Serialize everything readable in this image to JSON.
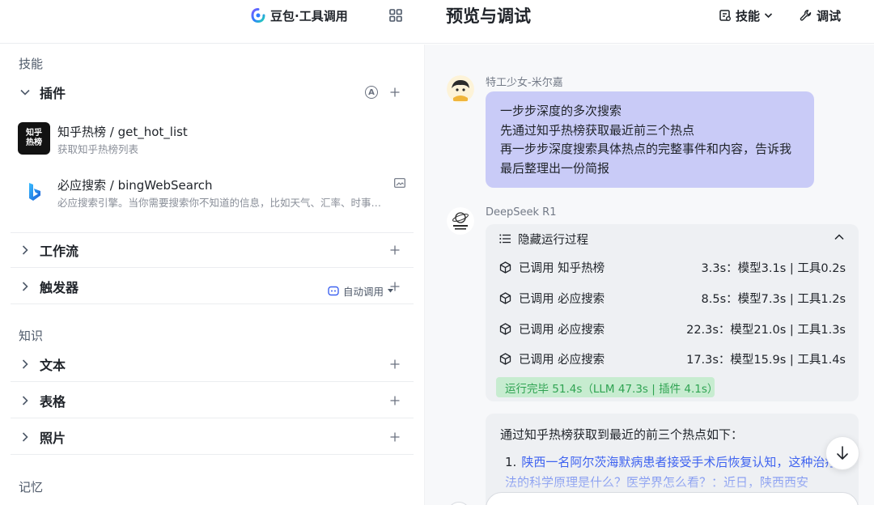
{
  "header": {
    "app_title": "豆包·工具调用",
    "preview_title": "预览与调试",
    "skill_label": "技能",
    "debug_label": "调试"
  },
  "left": {
    "skills_label": "技能",
    "plugins_label": "插件",
    "plugins_badge": "A",
    "plugins": [
      {
        "name": "知乎热榜 / get_hot_list",
        "desc": "获取知乎热榜列表",
        "icon_text": "知乎\n热榜"
      },
      {
        "name": "必应搜索 / bingWebSearch",
        "desc": "必应搜索引擎。当你需要搜索你不知道的信息，比如天气、汇率、时事…"
      }
    ],
    "workflow_label": "工作流",
    "trigger_label": "触发器",
    "knowledge_label": "知识",
    "auto_call_label": "自动调用",
    "text_label": "文本",
    "table_label": "表格",
    "photo_label": "照片",
    "memory_label": "记忆"
  },
  "chat": {
    "user_name": "特工少女-米尔嘉",
    "user_message_lines": [
      "一步步深度的多次搜索",
      "先通过知乎热榜获取最近前三个热点",
      "再一步步深度搜索具体热点的完整事件和内容，告诉我",
      "最后整理出一份简报"
    ],
    "bot_name": "DeepSeek R1",
    "run_header": "隐藏运行过程",
    "calls": [
      {
        "label": "已调用  知乎热榜",
        "time": "3.3s：模型3.1s | 工具0.2s"
      },
      {
        "label": "已调用  必应搜索",
        "time": "8.5s：模型7.3s | 工具1.2s"
      },
      {
        "label": "已调用  必应搜索",
        "time": "22.3s：模型21.0s | 工具1.3s"
      },
      {
        "label": "已调用  必应搜索",
        "time": "17.3s：模型15.9s | 工具1.4s"
      }
    ],
    "done_text": "运行完毕 51.4s（LLM 47.3s | 插件 4.1s）",
    "answer_intro": "通过知乎热榜获取到最近的前三个热点如下：",
    "answer_item_num": "1.",
    "answer_item_text": "陕西一名阿尔茨海默病患者接受手术后恢复认知，这种治疗方法的科学原理是什么？医学界怎么看？：近日，陕西西安"
  },
  "colors": {
    "user_bubble": "#c9cbf7",
    "done_badge_bg": "#c7ecd0",
    "done_badge_text": "#2fa352",
    "link_blue": "#3f63f0"
  }
}
